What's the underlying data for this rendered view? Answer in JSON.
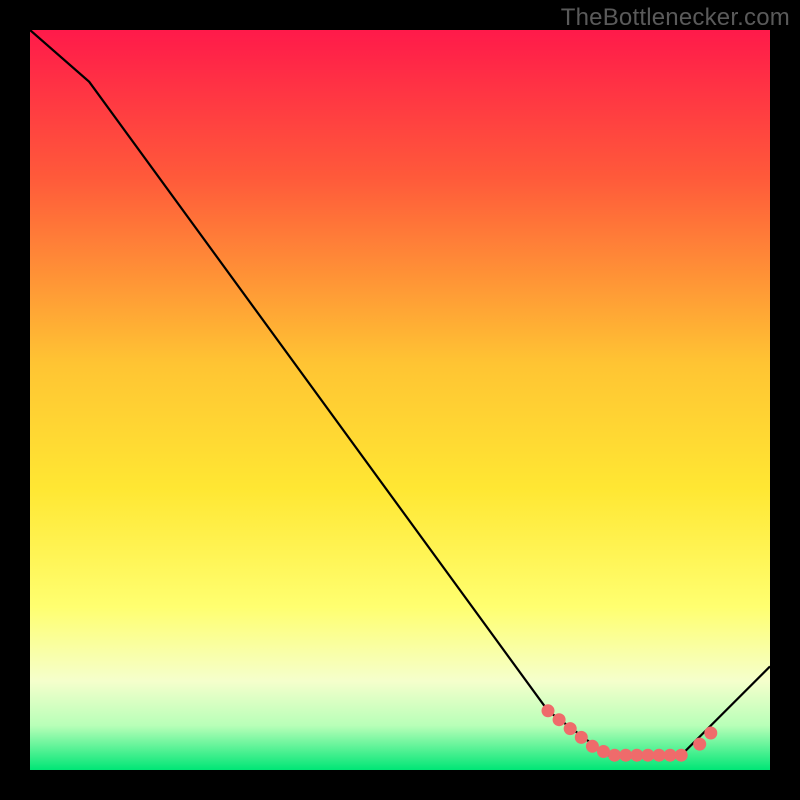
{
  "watermark": "TheBottlenecker.com",
  "chart_data": {
    "type": "line",
    "title": "",
    "xlabel": "",
    "ylabel": "",
    "xlim": [
      0,
      100
    ],
    "ylim": [
      0,
      100
    ],
    "gradient_stops": [
      {
        "pct": 0,
        "color": "#ff1a4a"
      },
      {
        "pct": 20,
        "color": "#ff5a3a"
      },
      {
        "pct": 45,
        "color": "#ffc433"
      },
      {
        "pct": 62,
        "color": "#ffe733"
      },
      {
        "pct": 78,
        "color": "#ffff70"
      },
      {
        "pct": 88,
        "color": "#f5ffcc"
      },
      {
        "pct": 94,
        "color": "#b8ffb8"
      },
      {
        "pct": 100,
        "color": "#00e676"
      }
    ],
    "series": [
      {
        "name": "bottleneck-curve",
        "x": [
          0,
          8,
          70,
          78,
          88,
          100
        ],
        "y": [
          100,
          93,
          8,
          2,
          2,
          14
        ]
      }
    ],
    "marker_points": {
      "name": "highlighted-range",
      "x": [
        70,
        71.5,
        73,
        74.5,
        76,
        77.5,
        79,
        80.5,
        82,
        83.5,
        85,
        86.5,
        88,
        90.5,
        92
      ],
      "y": [
        8,
        6.8,
        5.6,
        4.4,
        3.2,
        2.5,
        2,
        2,
        2,
        2,
        2,
        2,
        2,
        3.5,
        5
      ]
    }
  }
}
